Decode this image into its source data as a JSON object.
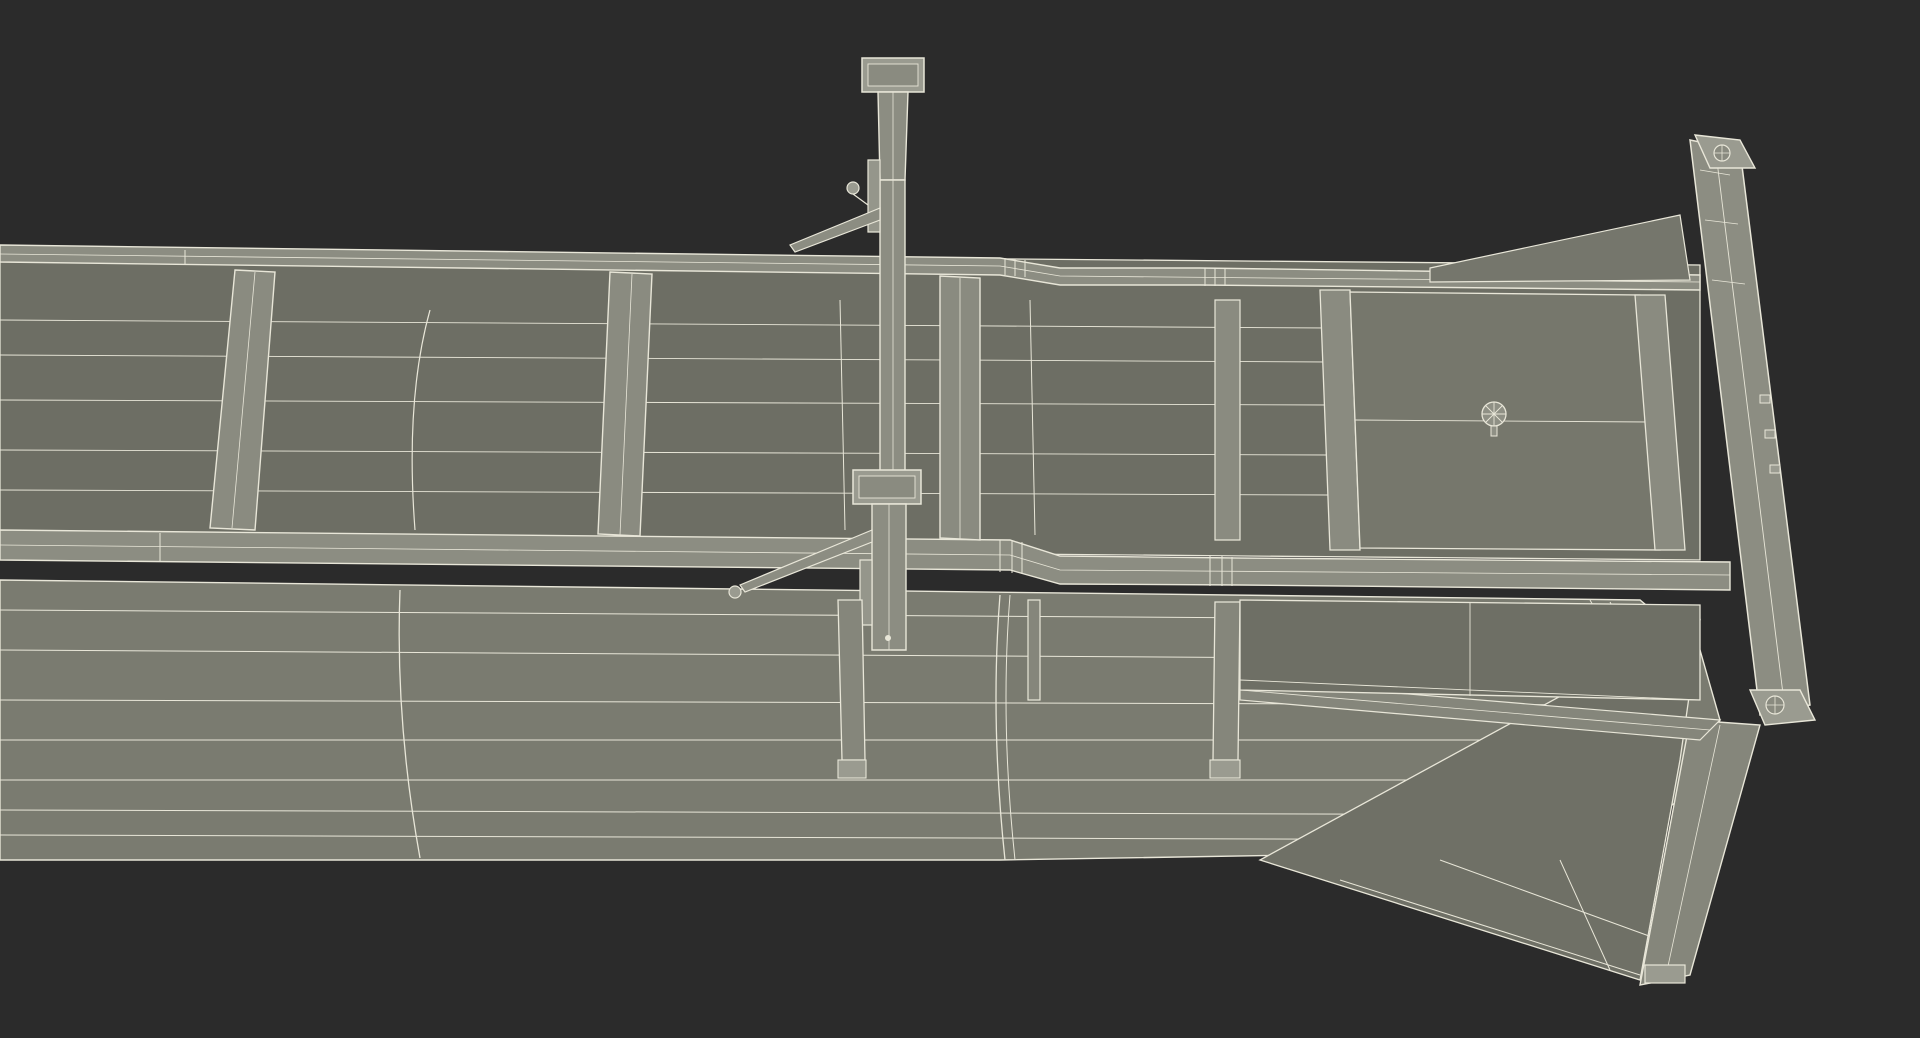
{
  "colors": {
    "background": "#2b2b2b",
    "body_fill": "#7c7d72",
    "body_fill_light": "#8a8b80",
    "body_fill_dark": "#6a6b61",
    "wire": "#e8e6d8",
    "wire_dim": "#b9b8aa",
    "deck_fill": "#76776c"
  }
}
